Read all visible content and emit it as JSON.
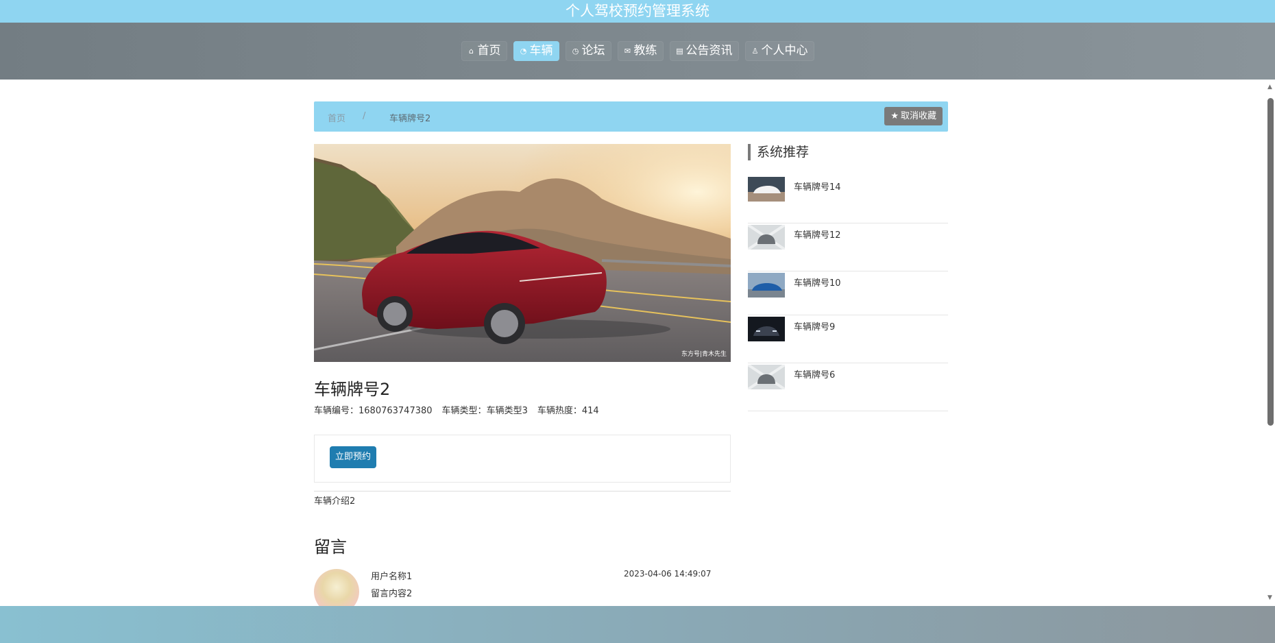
{
  "app": {
    "title": "个人驾校预约管理系统"
  },
  "nav": {
    "items": [
      {
        "label": "首页",
        "icon": "home-icon",
        "glyph": "⌂"
      },
      {
        "label": "车辆",
        "icon": "dashboard-icon",
        "glyph": "◔"
      },
      {
        "label": "论坛",
        "icon": "clock-icon",
        "glyph": "◷"
      },
      {
        "label": "教练",
        "icon": "mail-icon",
        "glyph": "✉"
      },
      {
        "label": "公告资讯",
        "icon": "news-icon",
        "glyph": "▤"
      },
      {
        "label": "个人中心",
        "icon": "user-icon",
        "glyph": "♙"
      }
    ],
    "active_index": 1
  },
  "breadcrumb": {
    "home": "首页",
    "separator": "/",
    "current": "车辆牌号2"
  },
  "favorite_button": {
    "icon": "star-icon",
    "glyph": "★",
    "label": "取消收藏"
  },
  "vehicle": {
    "photo_watermark": "东方号|青木先生",
    "title": "车辆牌号2",
    "number_label": "车辆编号：",
    "number": "1680763747380",
    "type_label": "车辆类型：",
    "type": "车辆类型3",
    "heat_label": "车辆热度：",
    "heat": "414",
    "book_button": "立即预约",
    "intro": "车辆介绍2"
  },
  "comments": {
    "title": "留言",
    "items": [
      {
        "user": "用户名称1",
        "text": "留言内容2",
        "time": "2023-04-06 14:49:07"
      }
    ]
  },
  "sidebar": {
    "title": "系统推荐",
    "items": [
      {
        "name": "车辆牌号14"
      },
      {
        "name": "车辆牌号12"
      },
      {
        "name": "车辆牌号10"
      },
      {
        "name": "车辆牌号9"
      },
      {
        "name": "车辆牌号6"
      }
    ]
  },
  "colors": {
    "accent": "#8fd5f1",
    "nav_bg": "#7b858b",
    "primary_button": "#1f7db0",
    "favorite_button": "#7a7a7a"
  }
}
